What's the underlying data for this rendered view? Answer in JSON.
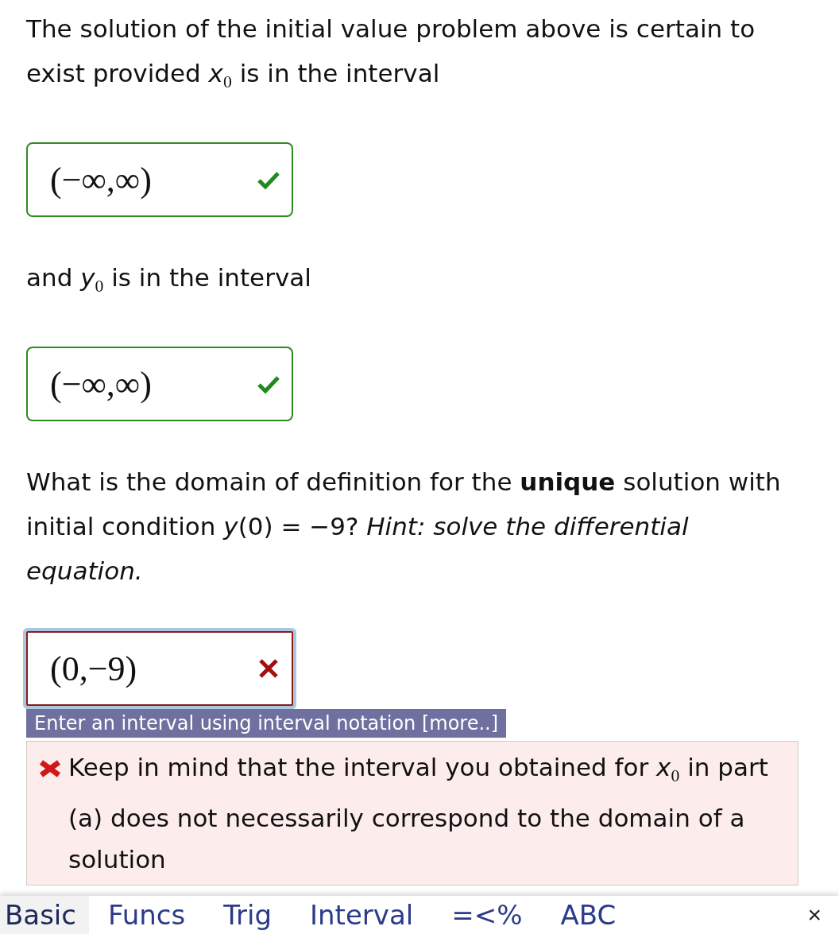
{
  "question": [
    {
      "kind": "text",
      "text": "The solution of the initial value problem above is certain to exist provided *x*$_{0}$ is in the interval"
    },
    {
      "kind": "answer",
      "value": "(−∞,∞)",
      "correct": true,
      "focused": false
    },
    {
      "kind": "text",
      "text": "and *y*$_{0}$ is in the interval"
    },
    {
      "kind": "answer",
      "value": "(−∞,∞)",
      "correct": true,
      "focused": false
    },
    {
      "kind": "text",
      "text": "What is the domain of definition for the **unique** solution with initial condition *y*(0) = −9? *Hint: solve the differential equation.*"
    },
    {
      "kind": "answer",
      "value": "(0,−9)",
      "correct": false,
      "focused": true
    }
  ],
  "tooltip": "Enter an interval using interval notation [more..]",
  "feedback": {
    "correct": false,
    "text": "Keep in mind that the interval you obtained for *x*$_{0}$ in part (a) does not necessarily correspond to the domain of a solution"
  },
  "keyboard": {
    "tabs": [
      {
        "label": "Basic",
        "selected": true
      },
      {
        "label": "Funcs",
        "selected": false
      },
      {
        "label": "Trig",
        "selected": false
      },
      {
        "label": "Interval",
        "selected": false
      },
      {
        "label": "=<%",
        "selected": false
      },
      {
        "label": "ABC",
        "selected": false
      }
    ],
    "close": "×"
  }
}
